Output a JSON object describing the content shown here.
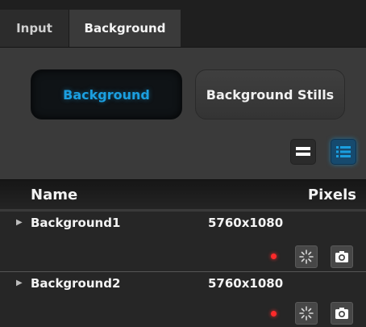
{
  "tabs": [
    {
      "label": "Input"
    },
    {
      "label": "Background"
    }
  ],
  "mode_buttons": {
    "background": "Background",
    "stills": "Background Stills"
  },
  "colors": {
    "accent": "#1b9fe0",
    "status_dot": "#ff2a2a"
  },
  "table": {
    "headers": {
      "name": "Name",
      "pixels": "Pixels"
    },
    "rows": [
      {
        "name": "Background1",
        "pixels": "5760x1080"
      },
      {
        "name": "Background2",
        "pixels": "5760x1080"
      }
    ]
  },
  "icons": {
    "expand": "triangle-right-icon",
    "rows_view": "rows-view-icon",
    "list_view": "list-view-icon",
    "dot": "red-status-dot",
    "effects": "sparkle-icon",
    "snapshot": "camera-icon"
  }
}
